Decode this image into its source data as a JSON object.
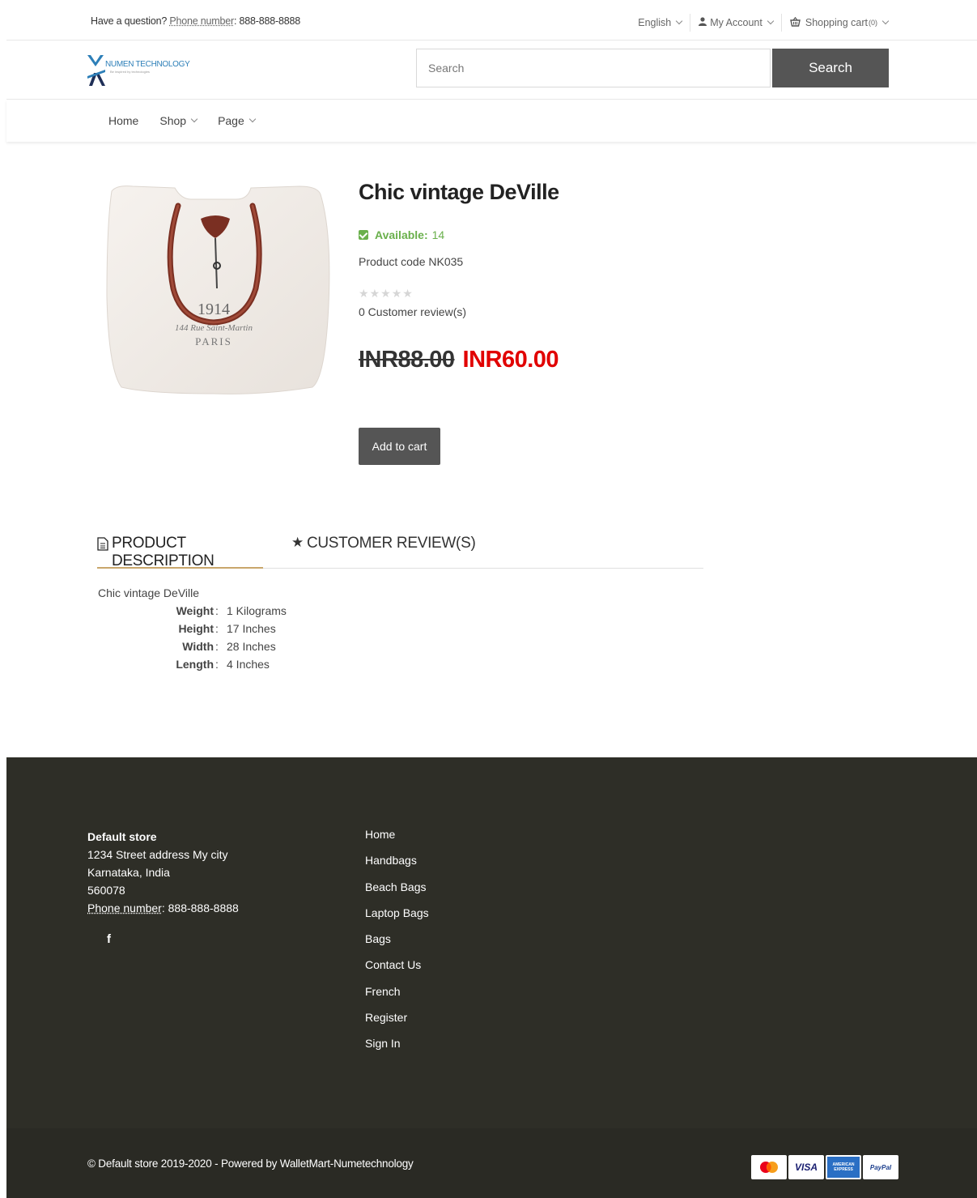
{
  "topbar": {
    "question": "Have a question?",
    "phone_label": "Phone number",
    "phone_value": ": 888-888-8888",
    "language": "English",
    "account": "My Account",
    "cart_label": "Shopping cart",
    "cart_count": "(0)"
  },
  "header": {
    "logo_text": "NUMEN TECHNOLOGY",
    "logo_tagline": "Be inspired by technologies",
    "search_placeholder": "Search",
    "search_button": "Search"
  },
  "nav": {
    "items": [
      {
        "label": "Home"
      },
      {
        "label": "Shop"
      },
      {
        "label": "Page"
      }
    ]
  },
  "product": {
    "title": "Chic vintage DeVille",
    "availability_label": "Available:",
    "availability_qty": "14",
    "product_code": "Product code NK035",
    "rating": 0,
    "reviews": "0 Customer review(s)",
    "old_price": "INR88.00",
    "new_price": "INR60.00",
    "add_to_cart": "Add to cart",
    "image_text": {
      "line1": "1914",
      "line2": "144 Rue Saint-Martin",
      "line3": "PARIS"
    }
  },
  "tabs": {
    "description": "PRODUCT DESCRIPTION",
    "reviews": "CUSTOMER REVIEW(S)"
  },
  "description": {
    "text": "Chic vintage DeVille",
    "specs": [
      {
        "key": "Weight",
        "value": "1  Kilograms"
      },
      {
        "key": "Height",
        "value": "17  Inches"
      },
      {
        "key": "Width",
        "value": "28  Inches"
      },
      {
        "key": "Length",
        "value": "4  Inches"
      }
    ]
  },
  "footer": {
    "store_name": "Default store",
    "address1": "1234 Street address My city",
    "address2": "Karnataka, India",
    "zip": "560078",
    "phone_label": "Phone number",
    "phone_value": ": 888-888-8888",
    "facebook_icon": "f",
    "links": [
      {
        "label": "Home"
      },
      {
        "label": "Handbags"
      },
      {
        "label": "Beach Bags"
      },
      {
        "label": "Laptop Bags"
      },
      {
        "label": "Bags"
      },
      {
        "label": "Contact Us"
      },
      {
        "label": "French"
      },
      {
        "label": "Register"
      },
      {
        "label": "Sign In"
      }
    ],
    "copyright": "© Default store 2019-2020 - Powered by WalletMart-Numetechnology",
    "payments": {
      "visa": "VISA",
      "amex": "AMERICAN EXPRESS",
      "paypal": "PayPal"
    }
  },
  "colors": {
    "accent_button": "#555555",
    "available_green": "#6ab04c",
    "sale_red": "#e10000",
    "footer_bg": "#2e2e27",
    "tab_underline": "#c9a66b"
  }
}
